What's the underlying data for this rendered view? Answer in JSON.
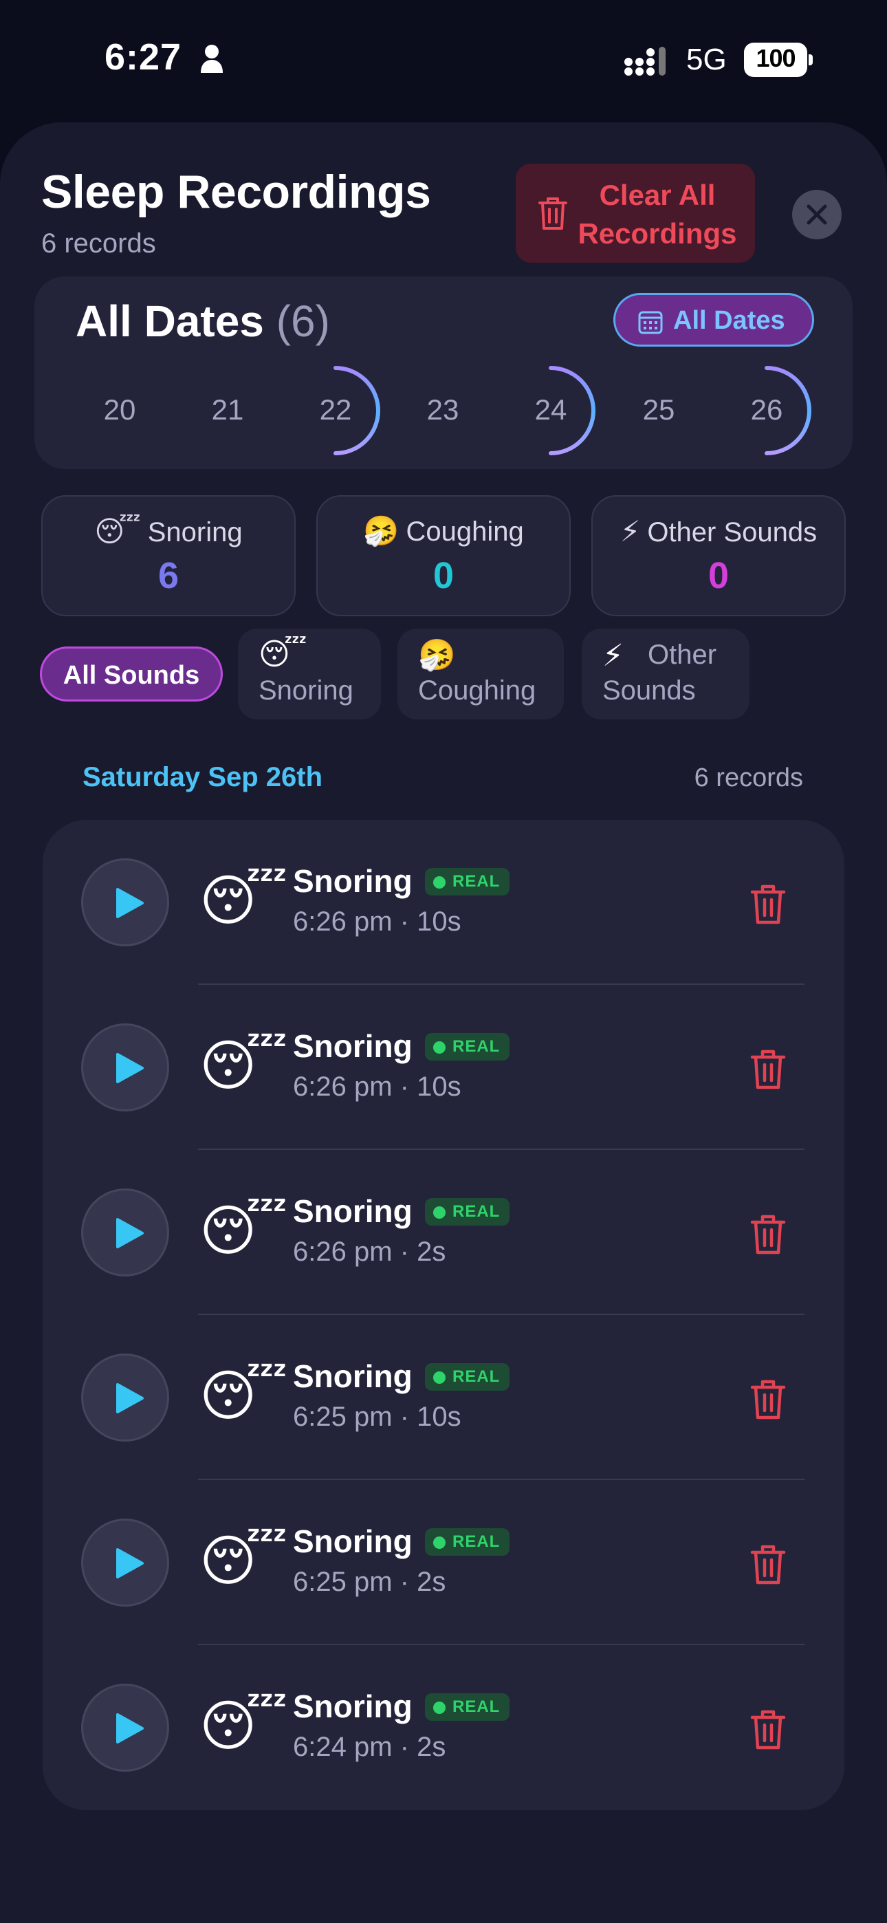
{
  "status_bar": {
    "time": "6:27",
    "person_icon": "person-icon",
    "signal_icon": "cellular-signal-icon",
    "network": "5G",
    "battery": "100"
  },
  "header": {
    "title": "Sleep Recordings",
    "subtitle": "6 records",
    "clear_all_label": "Clear All Recordings",
    "clear_icon": "trash-icon",
    "close_icon": "close-icon"
  },
  "date_filter": {
    "heading": "All Dates",
    "count": "(6)",
    "button_label": "All Dates",
    "button_icon": "calendar-icon",
    "days": [
      {
        "label": "20",
        "ring": false
      },
      {
        "label": "21",
        "ring": false
      },
      {
        "label": "22",
        "ring": true
      },
      {
        "label": "23",
        "ring": false
      },
      {
        "label": "24",
        "ring": true
      },
      {
        "label": "25",
        "ring": false
      },
      {
        "label": "26",
        "ring": true
      }
    ]
  },
  "stats": [
    {
      "emoji": "😴",
      "label": "Snoring",
      "value": "6",
      "color": "#7b79f0"
    },
    {
      "emoji": "🤧",
      "label": "Coughing",
      "value": "0",
      "color": "#22c7d6"
    },
    {
      "emoji": "⚡",
      "label": "Other Sounds",
      "value": "0",
      "color": "#d33fdb"
    }
  ],
  "filters": {
    "all": "All Sounds",
    "snoring": {
      "emoji": "😴",
      "label": "Snoring"
    },
    "coughing": {
      "emoji": "🤧",
      "label": "Coughing"
    },
    "other": {
      "emoji": "⚡",
      "label_top": "Other",
      "label_bottom": "Sounds"
    }
  },
  "section": {
    "date": "Saturday Sep 26th",
    "count": "6 records"
  },
  "recordings": [
    {
      "emoji": "😴",
      "title": "Snoring",
      "badge": "REAL",
      "meta": "6:26 pm · 10s"
    },
    {
      "emoji": "😴",
      "title": "Snoring",
      "badge": "REAL",
      "meta": "6:26 pm · 10s"
    },
    {
      "emoji": "😴",
      "title": "Snoring",
      "badge": "REAL",
      "meta": "6:26 pm · 2s"
    },
    {
      "emoji": "😴",
      "title": "Snoring",
      "badge": "REAL",
      "meta": "6:25 pm · 10s"
    },
    {
      "emoji": "😴",
      "title": "Snoring",
      "badge": "REAL",
      "meta": "6:25 pm · 2s"
    },
    {
      "emoji": "😴",
      "title": "Snoring",
      "badge": "REAL",
      "meta": "6:24 pm · 2s"
    }
  ],
  "colors": {
    "background": "#0c0d1c",
    "sheet": "#1a1a2e",
    "card": "#23243a",
    "accent_purple": "#6a2d8e",
    "accent_blue": "#4cc3f5",
    "danger": "#ef4a5a",
    "real_badge": "#2fd36b"
  }
}
